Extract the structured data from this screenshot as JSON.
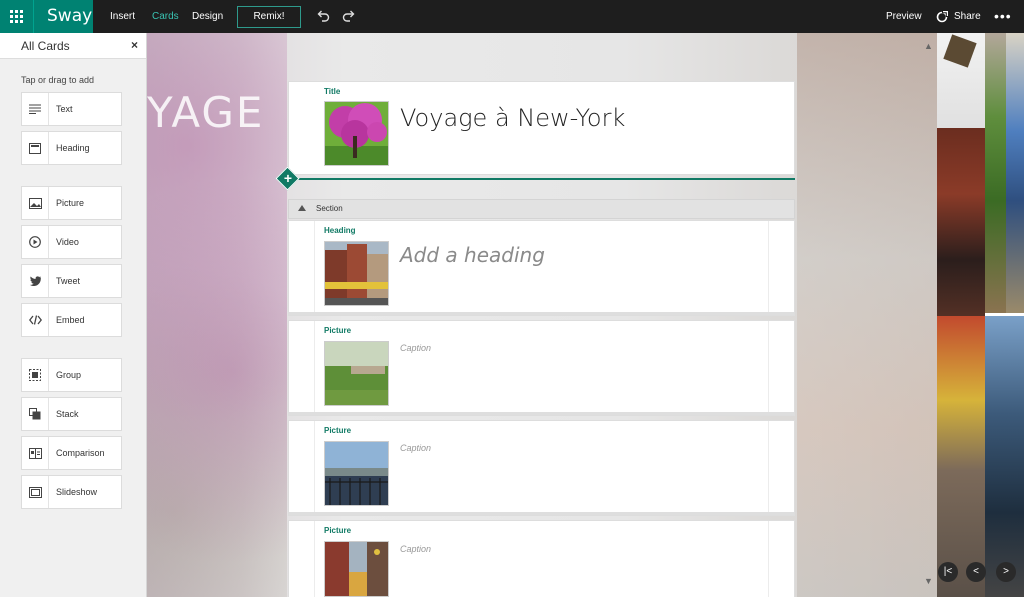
{
  "app": {
    "name": "Sway"
  },
  "topbar": {
    "insert": "Insert",
    "cards": "Cards",
    "design": "Design",
    "remix": "Remix!",
    "preview": "Preview",
    "share": "Share",
    "more": "•••"
  },
  "panel": {
    "title": "All Cards",
    "close": "×",
    "hint": "Tap or drag to add",
    "items": [
      {
        "label": "Text",
        "icon": "text-lines-icon"
      },
      {
        "label": "Heading",
        "icon": "heading-icon"
      },
      {
        "label": "Picture",
        "icon": "picture-icon"
      },
      {
        "label": "Video",
        "icon": "video-play-icon"
      },
      {
        "label": "Tweet",
        "icon": "twitter-bird-icon"
      },
      {
        "label": "Embed",
        "icon": "code-embed-icon"
      },
      {
        "label": "Group",
        "icon": "group-icon"
      },
      {
        "label": "Stack",
        "icon": "stack-icon"
      },
      {
        "label": "Comparison",
        "icon": "comparison-icon"
      },
      {
        "label": "Slideshow",
        "icon": "slideshow-icon"
      }
    ]
  },
  "canvas": {
    "background_text": "YAGE"
  },
  "story": {
    "title_card": {
      "label": "Title",
      "text": "Voyage à New-York"
    },
    "section": {
      "label": "Section"
    },
    "heading_card": {
      "label": "Heading",
      "placeholder": "Add a heading"
    },
    "picture_cards": [
      {
        "label": "Picture",
        "caption_placeholder": "Caption"
      },
      {
        "label": "Picture",
        "caption_placeholder": "Caption"
      },
      {
        "label": "Picture",
        "caption_placeholder": "Caption"
      }
    ]
  },
  "colors": {
    "accent": "#008272",
    "topbar": "#1e1e1e",
    "label_green": "#117a65"
  }
}
